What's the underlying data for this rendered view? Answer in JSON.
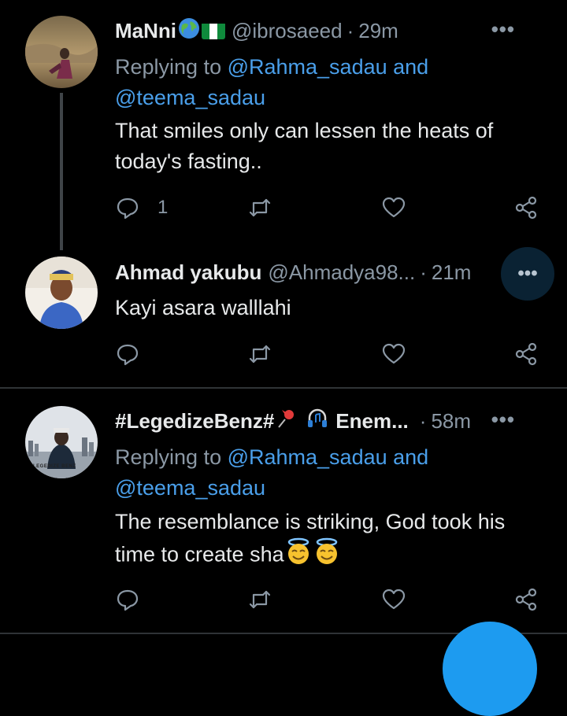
{
  "tweets": [
    {
      "name": "MaNni",
      "handle": "@ibrosaeed",
      "separator": "·",
      "time": "29m",
      "reply_prefix": "Replying to ",
      "reply_mention": "@Rahma_sadau and",
      "reply_mention2": "@teema_sadau",
      "text_line1": "That smiles only can lessen the heats of",
      "text_line2": "today's fasting..",
      "reply_count": "1",
      "more": "•••"
    },
    {
      "name": "Ahmad yakubu",
      "handle": "@Ahmadya98...",
      "separator": "·",
      "time": "21m",
      "text_line1": "Kayi asara walllahi",
      "more": "•••"
    },
    {
      "name": "#LegedizeBenz#",
      "name_suffix": "Enem...",
      "separator": "·",
      "time": "58m",
      "reply_prefix": "Replying to ",
      "reply_mention": "@Rahma_sadau and",
      "reply_mention2": "@teema_sadau",
      "text_line1": "The resemblance is striking, God took his",
      "text_line2": "time to create sha",
      "avatar_caption": "LEGEDIZE BENZ",
      "more": "•••"
    }
  ],
  "colors": {
    "background": "#000000",
    "link": "#4a9fea",
    "muted": "#8b98a5",
    "divider": "#2f3336",
    "fab": "#1d9bf0"
  },
  "icons": [
    "globe-icon",
    "nigeria-flag-icon",
    "reply-icon",
    "retweet-icon",
    "like-icon",
    "share-icon",
    "pushpin-icon",
    "headphones-icon",
    "halo-smile-emoji"
  ]
}
